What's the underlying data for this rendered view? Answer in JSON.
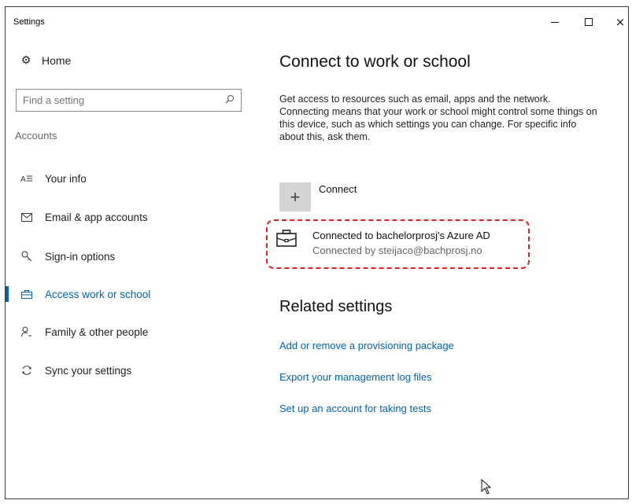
{
  "window": {
    "title": "Settings",
    "controls": {
      "minimize": "minimize-icon",
      "maximize": "maximize-icon",
      "close": "×"
    }
  },
  "sidebar": {
    "home": {
      "label": "Home",
      "icon": "gear-icon"
    },
    "search": {
      "placeholder": "Find a setting",
      "value": "",
      "icon": "search-icon"
    },
    "section_label": "Accounts",
    "items": [
      {
        "label": "Your info",
        "icon": "person-card-icon",
        "active": false
      },
      {
        "label": "Email & app accounts",
        "icon": "mail-icon",
        "active": false
      },
      {
        "label": "Sign-in options",
        "icon": "key-icon",
        "active": false
      },
      {
        "label": "Access work or school",
        "icon": "briefcase-icon",
        "active": true
      },
      {
        "label": "Family & other people",
        "icon": "people-icon",
        "active": false
      },
      {
        "label": "Sync your settings",
        "icon": "sync-icon",
        "active": false
      }
    ]
  },
  "main": {
    "title": "Connect to work or school",
    "description": "Get access to resources such as email, apps and the network. Connecting means that your work or school might control some things on this device, such as which settings you can change. For specific info about this, ask them.",
    "connect": {
      "label": "Connect",
      "icon_glyph": "+"
    },
    "account": {
      "name": "Connected to bachelorprosj's Azure AD",
      "subtitle": "Connected by steijaco@bachprosj.no",
      "icon": "briefcase-icon",
      "highlight_color": "#e02020"
    },
    "related": {
      "title": "Related settings",
      "links": [
        "Add or remove a provisioning package",
        "Export your management log files",
        "Set up an account for taking tests"
      ]
    }
  },
  "colors": {
    "accent": "#0063b1",
    "button_bg": "#d4d4d4"
  }
}
